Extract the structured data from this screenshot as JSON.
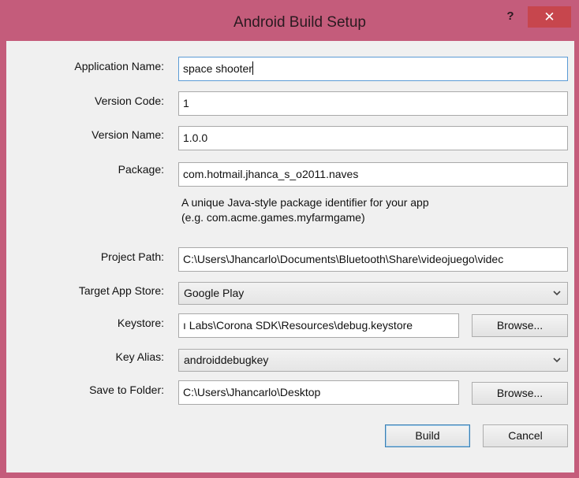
{
  "window": {
    "title": "Android Build Setup",
    "help_label": "?",
    "close_label": "✕"
  },
  "form": {
    "app_name": {
      "label": "Application Name:",
      "value": "space shooter"
    },
    "version_code": {
      "label": "Version Code:",
      "value": "1"
    },
    "version_name": {
      "label": "Version Name:",
      "value": "1.0.0"
    },
    "package": {
      "label": "Package:",
      "value": "com.hotmail.jhanca_s_o2011.naves",
      "hint_line1": "A unique Java-style package identifier for your app",
      "hint_line2": "(e.g. com.acme.games.myfarmgame)"
    },
    "project_path": {
      "label": "Project Path:",
      "value": "C:\\Users\\Jhancarlo\\Documents\\Bluetooth\\Share\\videojuego\\videc"
    },
    "target_store": {
      "label": "Target App Store:",
      "value": "Google Play"
    },
    "keystore": {
      "label": "Keystore:",
      "value": "ı Labs\\Corona SDK\\Resources\\debug.keystore",
      "browse_label": "Browse..."
    },
    "key_alias": {
      "label": "Key Alias:",
      "value": "androiddebugkey"
    },
    "save_folder": {
      "label": "Save to Folder:",
      "value": "C:\\Users\\Jhancarlo\\Desktop",
      "browse_label": "Browse..."
    }
  },
  "actions": {
    "build_label": "Build",
    "cancel_label": "Cancel"
  },
  "colors": {
    "titlebar": "#c45c7b",
    "close_button": "#c7464d",
    "client_bg": "#f0f0f0",
    "focus_border": "#5a9bd5"
  },
  "icons": {
    "dropdown": "chevron-down-icon",
    "close": "close-icon",
    "help": "help-icon"
  }
}
